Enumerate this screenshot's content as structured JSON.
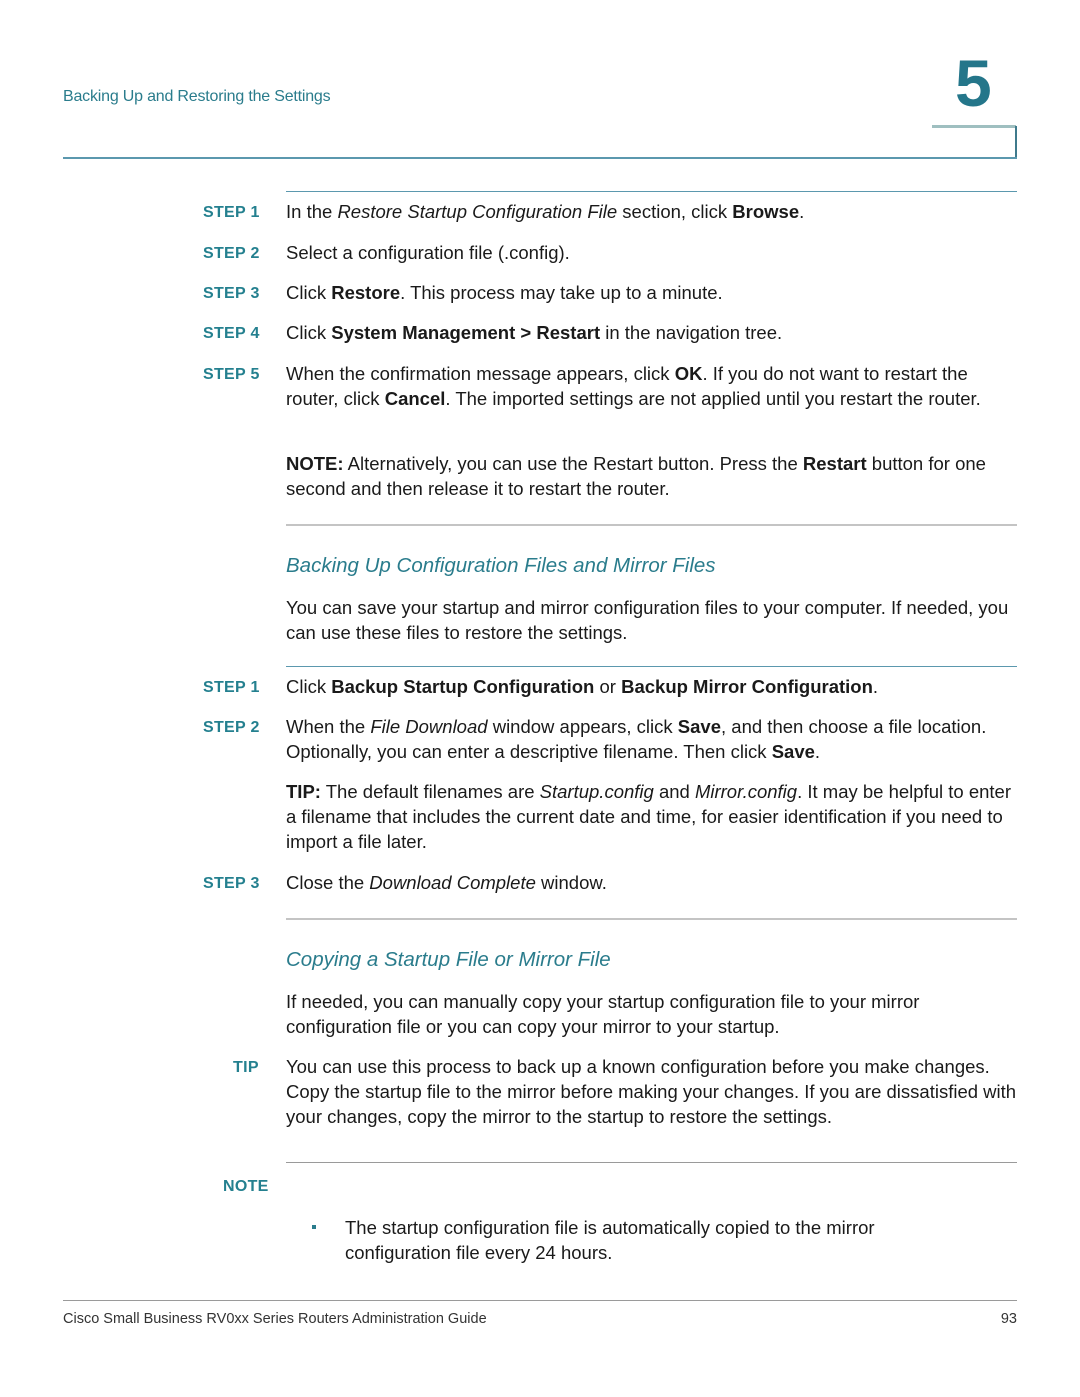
{
  "header": {
    "section_title": "Backing Up and Restoring the Settings",
    "chapter_number": "5"
  },
  "restore_steps": [
    {
      "label": "STEP 1",
      "parts": [
        [
          "",
          "In the "
        ],
        [
          "i",
          "Restore Startup Configuration File"
        ],
        [
          "",
          " section, click "
        ],
        [
          "b",
          "Browse"
        ],
        [
          "",
          "."
        ]
      ]
    },
    {
      "label": "STEP 2",
      "parts": [
        [
          "",
          "Select a configuration file (.config)."
        ]
      ]
    },
    {
      "label": "STEP 3",
      "parts": [
        [
          "",
          "Click "
        ],
        [
          "b",
          "Restore"
        ],
        [
          "",
          ". This process may take up to a minute."
        ]
      ]
    },
    {
      "label": "STEP 4",
      "parts": [
        [
          "",
          "Click "
        ],
        [
          "b",
          "System Management > Restart"
        ],
        [
          "",
          " in the navigation tree."
        ]
      ]
    },
    {
      "label": "STEP 5",
      "parts": [
        [
          "",
          "When the confirmation message appears, click "
        ],
        [
          "b",
          "OK"
        ],
        [
          "",
          ". If you do not want to restart the router, click "
        ],
        [
          "b",
          "Cancel"
        ],
        [
          "",
          ". The imported settings are not applied until you restart the router."
        ]
      ]
    }
  ],
  "restore_note": [
    [
      "b",
      "NOTE:"
    ],
    [
      "",
      " Alternatively, you can use the Restart button. Press the "
    ],
    [
      "b",
      "Restart"
    ],
    [
      "",
      " button for one second and then release it to restart the router."
    ]
  ],
  "backup_section": {
    "heading": "Backing Up Configuration Files and Mirror Files",
    "intro": "You can save your startup and mirror configuration files to your computer. If needed, you can use these files to restore the settings.",
    "steps": [
      {
        "label": "STEP 1",
        "parts": [
          [
            "",
            "Click "
          ],
          [
            "b",
            "Backup Startup Configuration"
          ],
          [
            "",
            " or "
          ],
          [
            "b",
            "Backup Mirror Configuration"
          ],
          [
            "",
            "."
          ]
        ]
      },
      {
        "label": "STEP 2",
        "parts": [
          [
            "",
            "When the "
          ],
          [
            "i",
            "File Download"
          ],
          [
            "",
            " window appears, click "
          ],
          [
            "b",
            "Save"
          ],
          [
            "",
            ", and then choose a file location. Optionally, you can enter a descriptive filename. Then click "
          ],
          [
            "b",
            "Save"
          ],
          [
            "",
            "."
          ]
        ]
      },
      {
        "label": "STEP 3",
        "parts": [
          [
            "",
            "Close the "
          ],
          [
            "i",
            "Download Complete"
          ],
          [
            "",
            " window."
          ]
        ]
      }
    ],
    "tip": [
      [
        "b",
        "TIP:"
      ],
      [
        "",
        " The default filenames are "
      ],
      [
        "i",
        "Startup.config"
      ],
      [
        "",
        " and "
      ],
      [
        "i",
        "Mirror.config"
      ],
      [
        "",
        ". It may be helpful to enter a filename that includes the current date and time, for easier identification if you need to import a file later."
      ]
    ]
  },
  "copy_section": {
    "heading": "Copying a Startup File or Mirror File",
    "intro": "If needed, you can manually copy your startup configuration file to your mirror configuration file or you can copy your mirror to your startup.",
    "tip_label": "TIP",
    "tip_text": "You can use this process to back up a known configuration before you make changes. Copy the startup file to the mirror before making your changes. If you are dissatisfied with your changes, copy the mirror to the startup to restore the settings.",
    "note_label": "NOTE",
    "note_bullet": "The startup configuration file is automatically copied to the mirror configuration file every 24 hours."
  },
  "footer": {
    "guide_title": "Cisco Small Business RV0xx Series Routers Administration Guide",
    "page_number": "93"
  }
}
